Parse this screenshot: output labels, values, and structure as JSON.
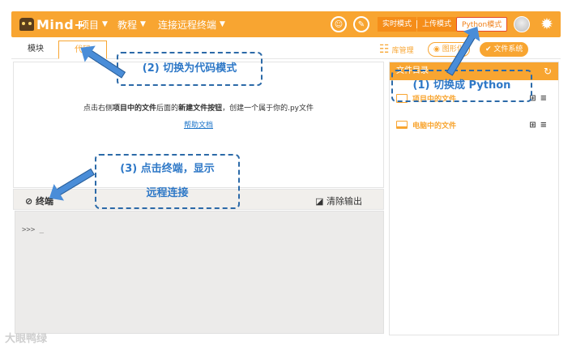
{
  "topbar": {
    "logo": "Mind+",
    "menus": [
      "项目",
      "教程",
      "连接远程终端"
    ],
    "modes": [
      "实时模式",
      "上传模式",
      "Python模式"
    ],
    "active_mode": "Python模式",
    "accent": "#f8a531"
  },
  "tabs": {
    "module": "模块",
    "code": "代码"
  },
  "tools": {
    "library": "库管理",
    "graphic": "图形化",
    "filesystem": "文件系统"
  },
  "editor": {
    "hint_prefix": "点击右侧",
    "hint_project_files": "项目中的文件",
    "hint_middle": "后面的",
    "hint_new_file": "新建文件按钮",
    "hint_suffix": "，创建一个属于你的.py文件",
    "help_link": "帮助文档"
  },
  "terminal": {
    "title": "终端",
    "clear": "清除输出",
    "prompt": ">>> _"
  },
  "file_panel": {
    "title": "文件目录",
    "items": [
      "项目中的文件",
      "电脑中的文件"
    ]
  },
  "annotations": {
    "step1": "(1) 切换成 Python",
    "step2": "(2) 切换为代码模式",
    "step3_line1": "(3) 点击终端，显示",
    "step3_line2": "远程连接"
  },
  "watermark": "大眼鸭绿"
}
